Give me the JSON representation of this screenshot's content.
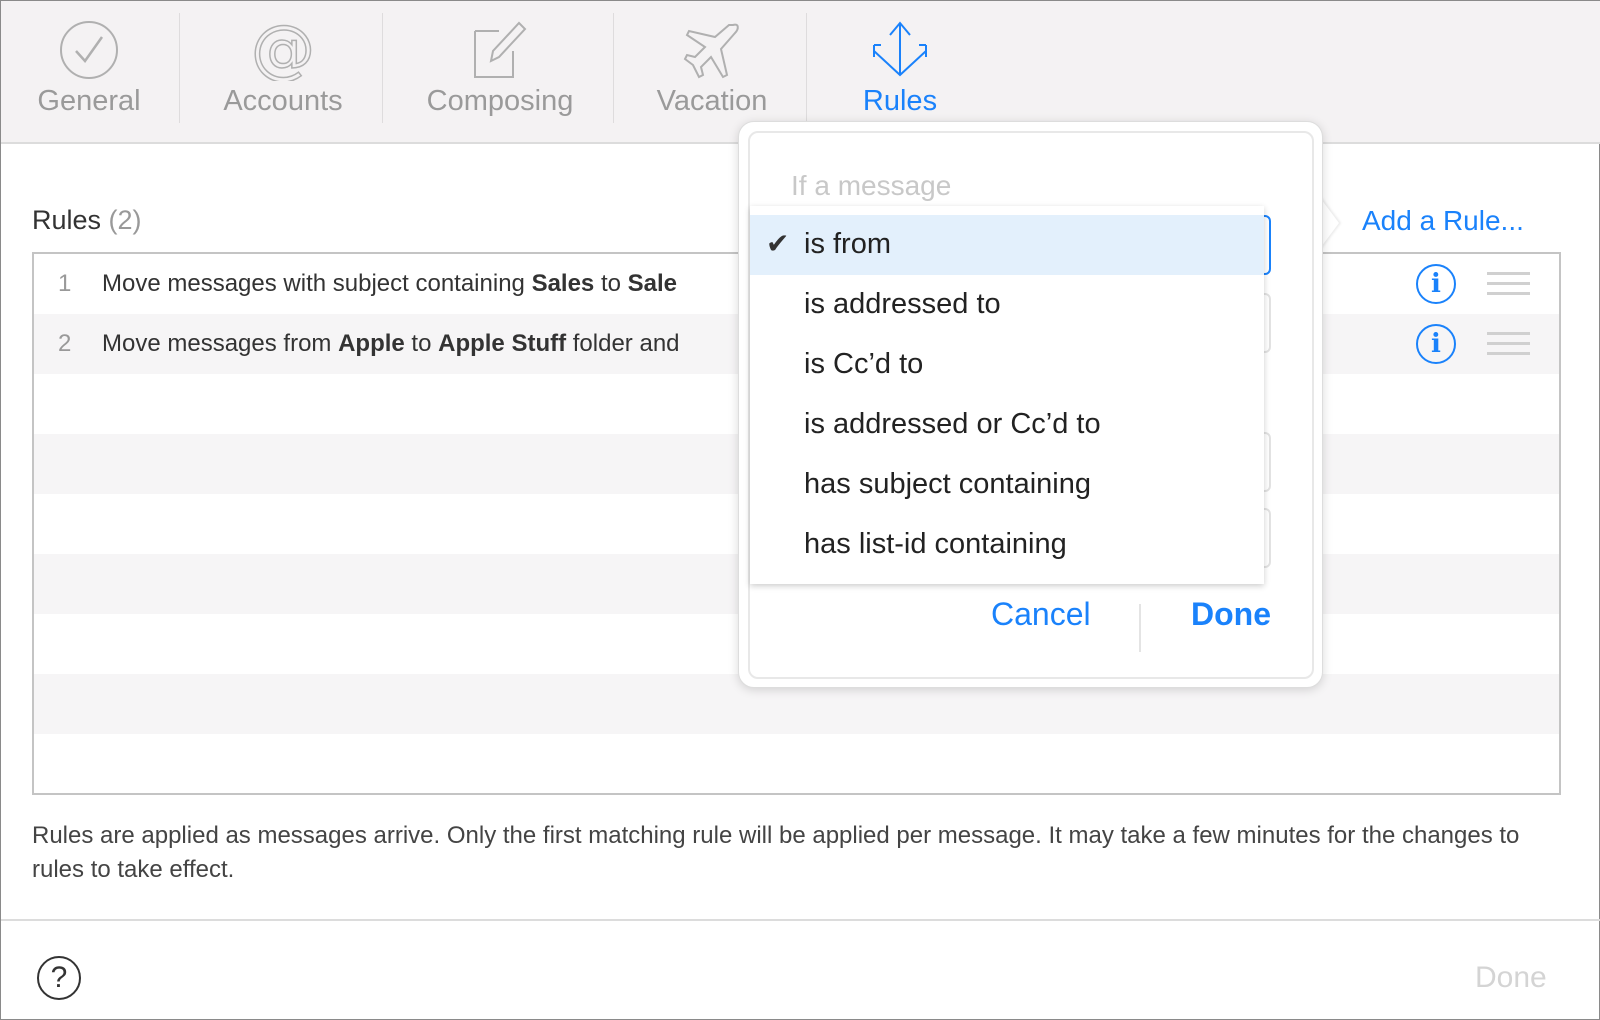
{
  "toolbar": {
    "tabs": [
      {
        "label": "General",
        "icon": "checkmark-circle-icon",
        "active": false
      },
      {
        "label": "Accounts",
        "icon": "at-sign-icon",
        "active": false
      },
      {
        "label": "Composing",
        "icon": "compose-pencil-icon",
        "active": false
      },
      {
        "label": "Vacation",
        "icon": "airplane-icon",
        "active": false
      },
      {
        "label": "Rules",
        "icon": "rules-arrows-icon",
        "active": true
      }
    ]
  },
  "rules": {
    "title": "Rules",
    "count": "(2)",
    "add_rule": "Add a Rule...",
    "items": [
      {
        "num": "1",
        "parts": [
          "Move messages with subject containing ",
          "Sales",
          " to ",
          "Sale"
        ]
      },
      {
        "num": "2",
        "parts": [
          "Move messages from ",
          "Apple",
          " to ",
          "Apple Stuff",
          " folder and"
        ]
      }
    ],
    "footnote": "Rules are applied as messages arrive. Only the first matching rule will be applied per message. It may take a few minutes for the changes to rules to take effect."
  },
  "footer": {
    "help": "?",
    "done": "Done"
  },
  "popover": {
    "title": "If a message",
    "options": [
      "is from",
      "is addressed to",
      "is Cc’d to",
      "is addressed or Cc’d to",
      "has subject containing",
      "has list-id containing"
    ],
    "selected": "is from",
    "checkmark": "✔",
    "cancel": "Cancel",
    "done": "Done"
  },
  "colors": {
    "accent": "#1a82fb",
    "toolbar_bg": "#f4f2f3",
    "selected_bg": "#e3f0fc"
  }
}
